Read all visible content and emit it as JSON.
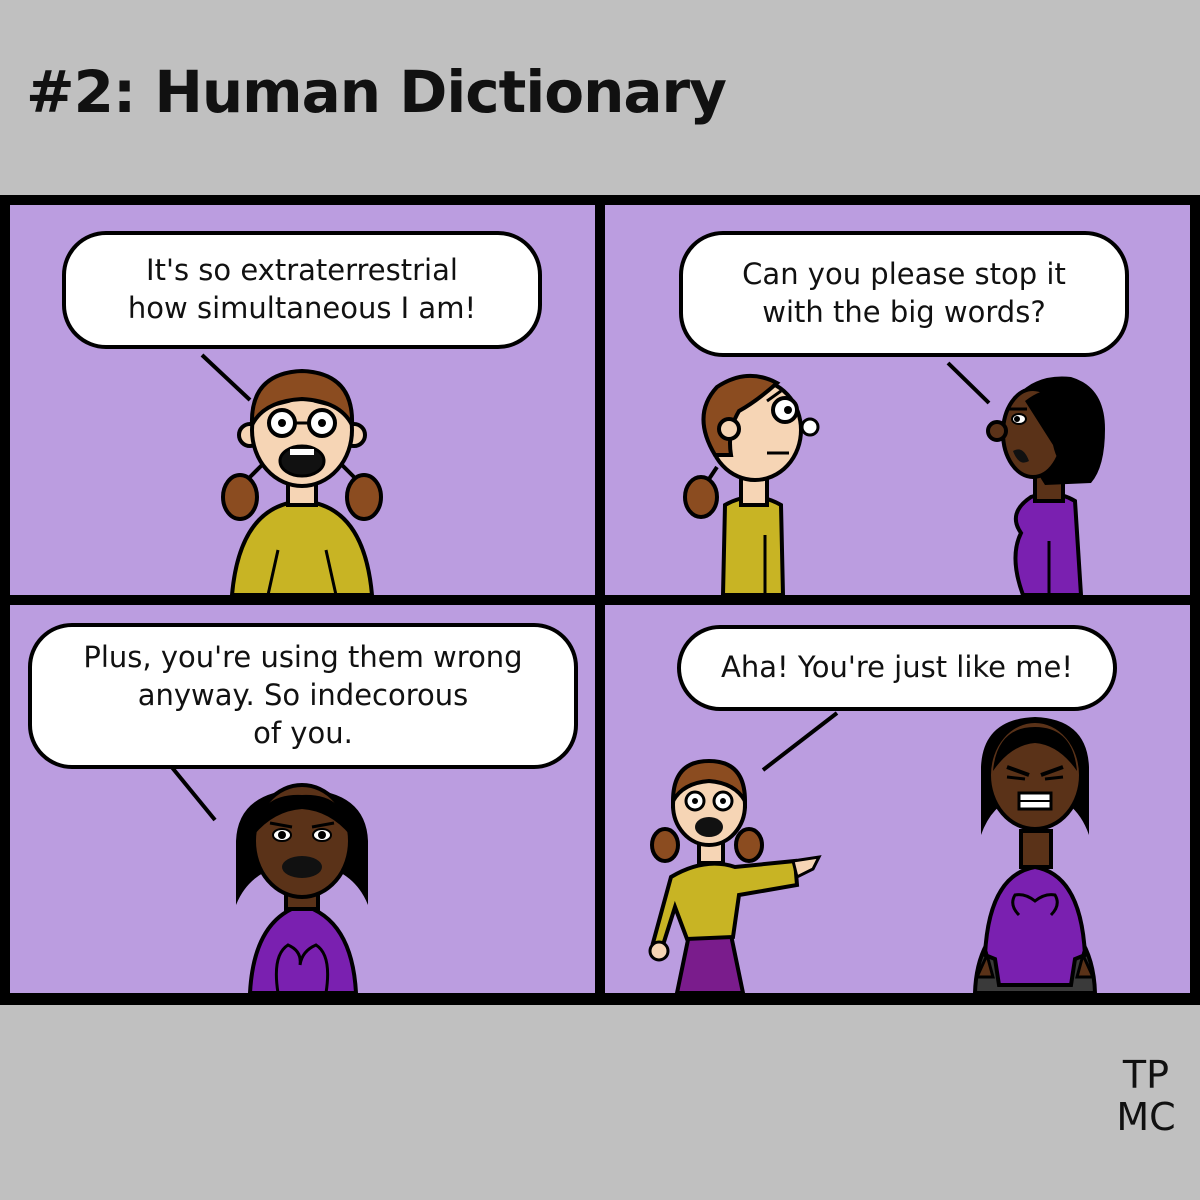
{
  "title": "#2: Human Dictionary",
  "colors": {
    "background": "#c0c0c0",
    "panel": "#bb9de0",
    "border": "#000000",
    "shirt_yellow": "#c8b424",
    "shirt_purple": "#7a20b0",
    "hair_brown": "#8b4c20",
    "skin_light": "#f6d5b5",
    "skin_dark": "#5a3218"
  },
  "panels": [
    {
      "speech": [
        "It's so extraterrestrial",
        "how simultaneous I am!"
      ]
    },
    {
      "speech": [
        "Can you please stop it",
        "with the big words?"
      ]
    },
    {
      "speech": [
        "Plus, you're using them wrong",
        "anyway. So indecorous",
        "of you."
      ]
    },
    {
      "speech": [
        "Aha! You're just like me!"
      ]
    }
  ],
  "signature": [
    "TP",
    "MC"
  ]
}
